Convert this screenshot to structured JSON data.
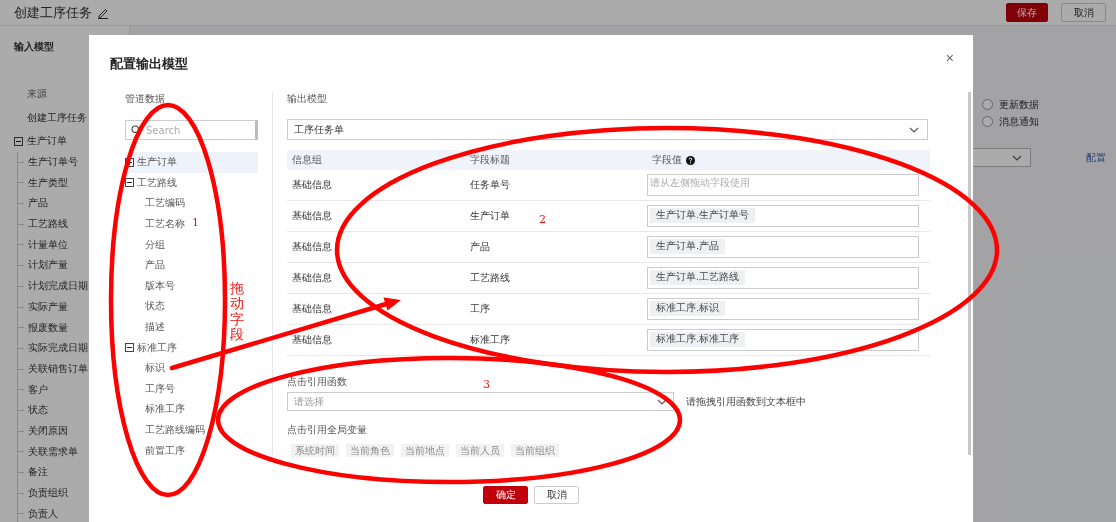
{
  "page": {
    "title": "创建工序任务",
    "buttons": [
      {
        "label": "保存",
        "kind": "primary"
      },
      {
        "label": "取消",
        "kind": "default"
      }
    ],
    "input_model": {
      "title": "输入模型",
      "source_label": "来源",
      "source_value": "创建工序任务",
      "tree": [
        {
          "label": "生产订单",
          "expanded": true,
          "children": [
            {
              "label": "生产订单号"
            },
            {
              "label": "生产类型"
            },
            {
              "label": "产品"
            },
            {
              "label": "工艺路线"
            },
            {
              "label": "计量单位"
            },
            {
              "label": "计划产量"
            },
            {
              "label": "计划完成日期"
            },
            {
              "label": "实际产量"
            },
            {
              "label": "报废数量"
            },
            {
              "label": "实际完成日期"
            },
            {
              "label": "关联销售订单"
            },
            {
              "label": "客户"
            },
            {
              "label": "状态"
            },
            {
              "label": "关闭原因"
            },
            {
              "label": "关联需求单"
            },
            {
              "label": "备注"
            },
            {
              "label": "负责组织"
            },
            {
              "label": "负责人"
            }
          ]
        }
      ]
    },
    "options": [
      {
        "label": "更新数据",
        "selected": false
      },
      {
        "label": "消息通知",
        "selected": false
      }
    ],
    "config_link": "配置"
  },
  "dialog": {
    "title": "配置输出模型",
    "close": "×",
    "pipeline": {
      "title": "管道数据",
      "search_placeholder": "Search",
      "tree": [
        {
          "label": "生产订单",
          "expanded": false,
          "selected": true
        },
        {
          "label": "工艺路线",
          "expanded": true,
          "selected": false,
          "children": [
            {
              "label": "工艺编码",
              "selected": false
            },
            {
              "label": "工艺名称",
              "selected": false
            },
            {
              "label": "分组",
              "selected": false
            },
            {
              "label": "产品",
              "selected": false
            },
            {
              "label": "版本号",
              "selected": false
            },
            {
              "label": "状态",
              "selected": false
            },
            {
              "label": "描述",
              "selected": false
            }
          ]
        },
        {
          "label": "标准工序",
          "expanded": true,
          "selected": false,
          "children": [
            {
              "label": "标识",
              "selected": false
            },
            {
              "label": "工序号",
              "selected": false
            },
            {
              "label": "标准工序",
              "selected": false
            },
            {
              "label": "工艺路线编码",
              "selected": false
            },
            {
              "label": "前置工序",
              "selected": false
            }
          ]
        }
      ]
    },
    "output": {
      "title": "输出模型",
      "model": "工序任务单",
      "table": {
        "columns": [
          "信息组",
          "字段标题",
          "字段值"
        ],
        "rows": [
          {
            "group": "基础信息",
            "field": "任务单号",
            "placeholder": "请从左侧拖动字段使用"
          },
          {
            "group": "基础信息",
            "field": "生产订单",
            "tag": "生产订单.生产订单号"
          },
          {
            "group": "基础信息",
            "field": "产品",
            "tag": "生产订单.产品"
          },
          {
            "group": "基础信息",
            "field": "工艺路线",
            "tag": "生产订单.工艺路线"
          },
          {
            "group": "基础信息",
            "field": "工序",
            "tag": "标准工序.标识"
          },
          {
            "group": "基础信息",
            "field": "标准工序",
            "tag": "标准工序.标准工序"
          }
        ]
      }
    },
    "function": {
      "label": "点击引用函数",
      "placeholder": "请选择",
      "hint": "请拖拽引用函数到文本框中"
    },
    "globals": {
      "label": "点击引用全局变量",
      "tags": [
        "系统时间",
        "当前角色",
        "当前地点",
        "当前人员",
        "当前组织"
      ]
    },
    "buttons": [
      {
        "label": "确定",
        "kind": "primary"
      },
      {
        "label": "取消",
        "kind": "default"
      }
    ]
  },
  "annotations": [
    {
      "kind": "ellipse",
      "label": "1"
    },
    {
      "kind": "ellipse",
      "label": "2"
    },
    {
      "kind": "ellipse",
      "label": "3"
    },
    {
      "kind": "arrow",
      "label": "拖动字段"
    }
  ]
}
